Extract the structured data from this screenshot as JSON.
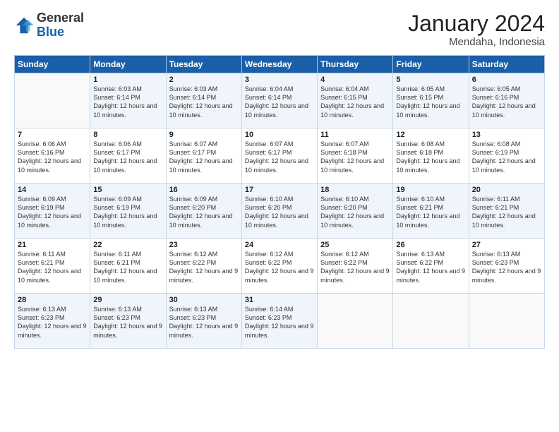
{
  "logo": {
    "general": "General",
    "blue": "Blue"
  },
  "title": "January 2024",
  "subtitle": "Mendaha, Indonesia",
  "days_of_week": [
    "Sunday",
    "Monday",
    "Tuesday",
    "Wednesday",
    "Thursday",
    "Friday",
    "Saturday"
  ],
  "weeks": [
    [
      {
        "day": "",
        "info": ""
      },
      {
        "day": "1",
        "info": "Sunrise: 6:03 AM\nSunset: 6:14 PM\nDaylight: 12 hours and 10 minutes."
      },
      {
        "day": "2",
        "info": "Sunrise: 6:03 AM\nSunset: 6:14 PM\nDaylight: 12 hours and 10 minutes."
      },
      {
        "day": "3",
        "info": "Sunrise: 6:04 AM\nSunset: 6:14 PM\nDaylight: 12 hours and 10 minutes."
      },
      {
        "day": "4",
        "info": "Sunrise: 6:04 AM\nSunset: 6:15 PM\nDaylight: 12 hours and 10 minutes."
      },
      {
        "day": "5",
        "info": "Sunrise: 6:05 AM\nSunset: 6:15 PM\nDaylight: 12 hours and 10 minutes."
      },
      {
        "day": "6",
        "info": "Sunrise: 6:05 AM\nSunset: 6:16 PM\nDaylight: 12 hours and 10 minutes."
      }
    ],
    [
      {
        "day": "7",
        "info": ""
      },
      {
        "day": "8",
        "info": "Sunrise: 6:06 AM\nSunset: 6:17 PM\nDaylight: 12 hours and 10 minutes."
      },
      {
        "day": "9",
        "info": "Sunrise: 6:07 AM\nSunset: 6:17 PM\nDaylight: 12 hours and 10 minutes."
      },
      {
        "day": "10",
        "info": "Sunrise: 6:07 AM\nSunset: 6:17 PM\nDaylight: 12 hours and 10 minutes."
      },
      {
        "day": "11",
        "info": "Sunrise: 6:07 AM\nSunset: 6:18 PM\nDaylight: 12 hours and 10 minutes."
      },
      {
        "day": "12",
        "info": "Sunrise: 6:08 AM\nSunset: 6:18 PM\nDaylight: 12 hours and 10 minutes."
      },
      {
        "day": "13",
        "info": "Sunrise: 6:08 AM\nSunset: 6:19 PM\nDaylight: 12 hours and 10 minutes."
      }
    ],
    [
      {
        "day": "14",
        "info": ""
      },
      {
        "day": "15",
        "info": "Sunrise: 6:09 AM\nSunset: 6:19 PM\nDaylight: 12 hours and 10 minutes."
      },
      {
        "day": "16",
        "info": "Sunrise: 6:09 AM\nSunset: 6:20 PM\nDaylight: 12 hours and 10 minutes."
      },
      {
        "day": "17",
        "info": "Sunrise: 6:10 AM\nSunset: 6:20 PM\nDaylight: 12 hours and 10 minutes."
      },
      {
        "day": "18",
        "info": "Sunrise: 6:10 AM\nSunset: 6:20 PM\nDaylight: 12 hours and 10 minutes."
      },
      {
        "day": "19",
        "info": "Sunrise: 6:10 AM\nSunset: 6:21 PM\nDaylight: 12 hours and 10 minutes."
      },
      {
        "day": "20",
        "info": "Sunrise: 6:11 AM\nSunset: 6:21 PM\nDaylight: 12 hours and 10 minutes."
      }
    ],
    [
      {
        "day": "21",
        "info": ""
      },
      {
        "day": "22",
        "info": "Sunrise: 6:11 AM\nSunset: 6:21 PM\nDaylight: 12 hours and 10 minutes."
      },
      {
        "day": "23",
        "info": "Sunrise: 6:12 AM\nSunset: 6:22 PM\nDaylight: 12 hours and 9 minutes."
      },
      {
        "day": "24",
        "info": "Sunrise: 6:12 AM\nSunset: 6:22 PM\nDaylight: 12 hours and 9 minutes."
      },
      {
        "day": "25",
        "info": "Sunrise: 6:12 AM\nSunset: 6:22 PM\nDaylight: 12 hours and 9 minutes."
      },
      {
        "day": "26",
        "info": "Sunrise: 6:13 AM\nSunset: 6:22 PM\nDaylight: 12 hours and 9 minutes."
      },
      {
        "day": "27",
        "info": "Sunrise: 6:13 AM\nSunset: 6:23 PM\nDaylight: 12 hours and 9 minutes."
      }
    ],
    [
      {
        "day": "28",
        "info": "Sunrise: 6:13 AM\nSunset: 6:23 PM\nDaylight: 12 hours and 9 minutes."
      },
      {
        "day": "29",
        "info": "Sunrise: 6:13 AM\nSunset: 6:23 PM\nDaylight: 12 hours and 9 minutes."
      },
      {
        "day": "30",
        "info": "Sunrise: 6:13 AM\nSunset: 6:23 PM\nDaylight: 12 hours and 9 minutes."
      },
      {
        "day": "31",
        "info": "Sunrise: 6:14 AM\nSunset: 6:23 PM\nDaylight: 12 hours and 9 minutes."
      },
      {
        "day": "",
        "info": ""
      },
      {
        "day": "",
        "info": ""
      },
      {
        "day": "",
        "info": ""
      }
    ]
  ],
  "week7_sundays": {
    "7": "Sunrise: 6:06 AM\nSunset: 6:16 PM\nDaylight: 12 hours and 10 minutes.",
    "14": "Sunrise: 6:09 AM\nSunset: 6:19 PM\nDaylight: 12 hours and 10 minutes.",
    "21": "Sunrise: 6:11 AM\nSunset: 6:21 PM\nDaylight: 12 hours and 10 minutes."
  }
}
